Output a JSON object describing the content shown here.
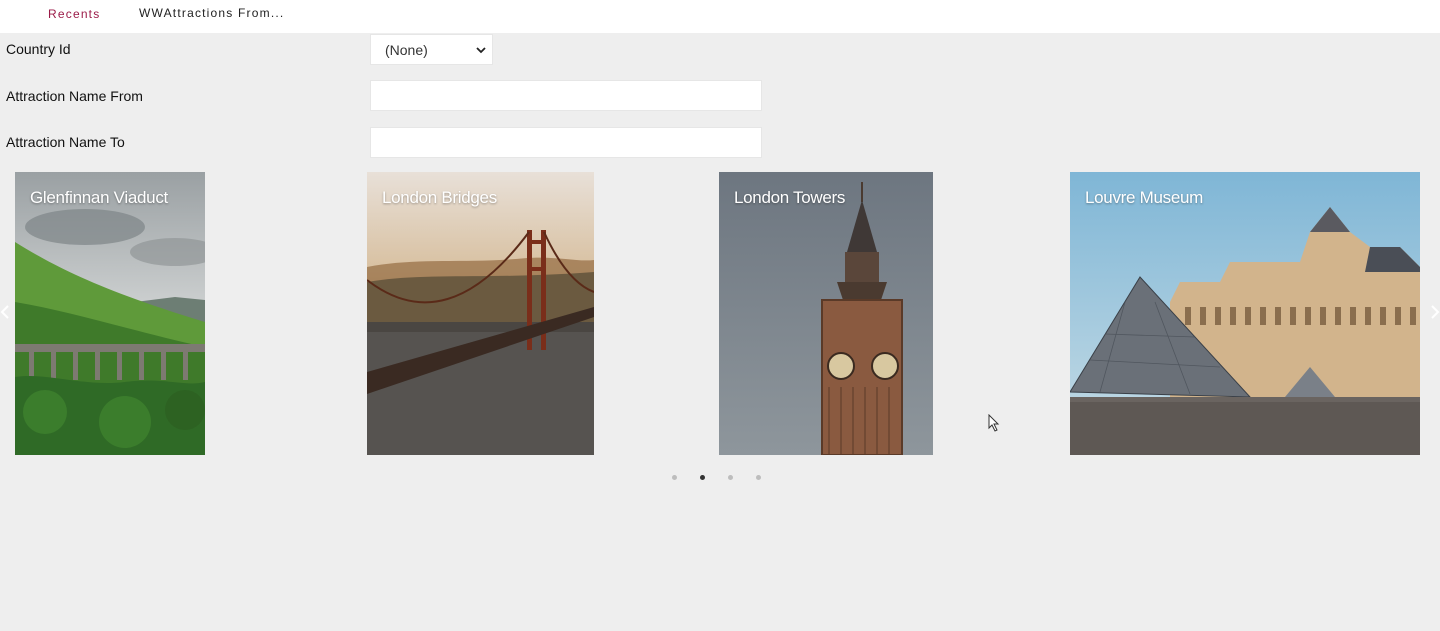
{
  "topbar": {
    "recents_label": "Recents",
    "current_label": "WWAttractions From..."
  },
  "filters": {
    "country_label": "Country Id",
    "country_value": "(None)",
    "name_from_label": "Attraction Name From",
    "name_from_value": "",
    "name_to_label": "Attraction Name To",
    "name_to_value": ""
  },
  "carousel": {
    "cards": [
      {
        "title": "Glenfinnan Viaduct"
      },
      {
        "title": "London Bridges"
      },
      {
        "title": "London Towers"
      },
      {
        "title": "Louvre Museum"
      }
    ],
    "page_count": 4,
    "active_page": 2
  },
  "colors": {
    "accent": "#9b1b48",
    "background": "#eeeeee"
  }
}
